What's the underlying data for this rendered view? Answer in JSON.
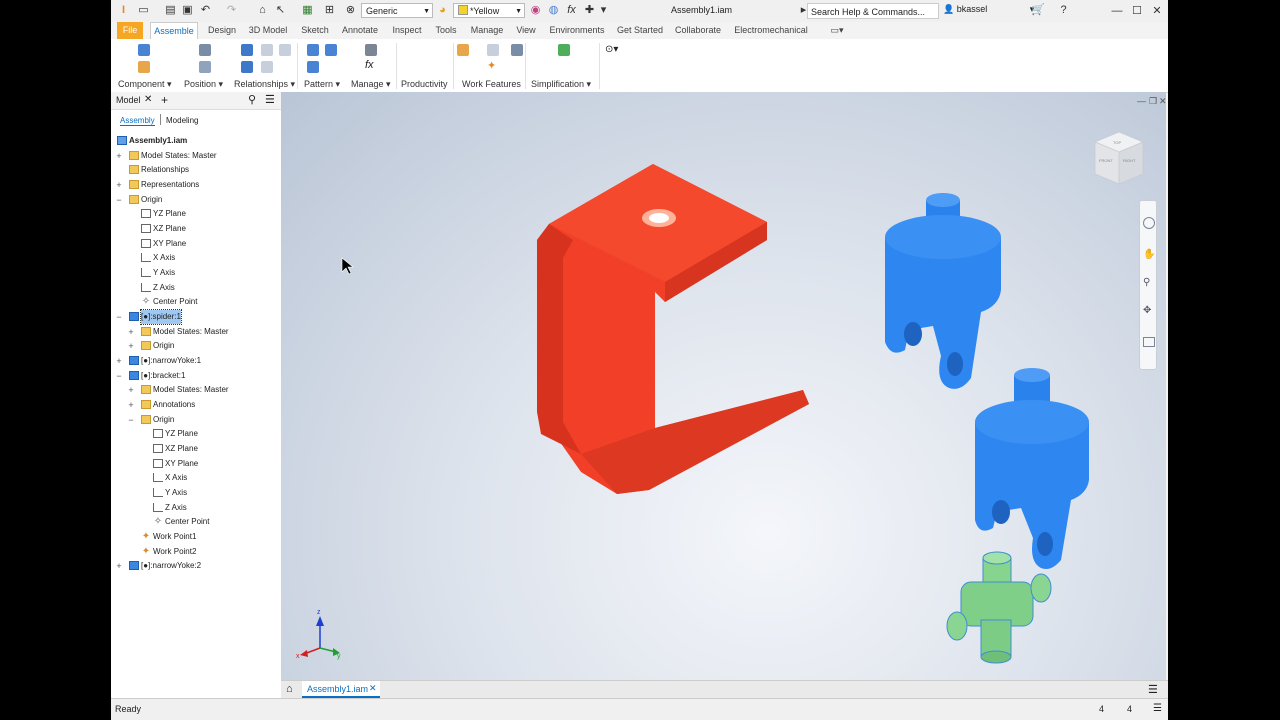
{
  "window": {
    "title": "Assembly1.iam",
    "search_placeholder": "Search Help & Commands...",
    "user": "bkassel",
    "appearance": "Generic",
    "color": "*Yellow"
  },
  "tabs": [
    "File",
    "Assemble",
    "Design",
    "3D Model",
    "Sketch",
    "Annotate",
    "Inspect",
    "Tools",
    "Manage",
    "View",
    "Environments",
    "Get Started",
    "Collaborate",
    "Electromechanical"
  ],
  "active_tab": "Assemble",
  "ribbon": {
    "panels": [
      "Component ▾",
      "Position ▾",
      "Relationships ▾",
      "Pattern ▾",
      "Manage ▾",
      "Productivity",
      "Work Features",
      "Simplification ▾"
    ]
  },
  "browser": {
    "tab_label": "Model",
    "views": [
      "Assembly",
      "Modeling"
    ],
    "tree": [
      {
        "label": "Assembly1.iam",
        "icon": "asm",
        "level": 0,
        "pm": "",
        "bold": true
      },
      {
        "label": "Model States: Master",
        "icon": "folder",
        "level": 1,
        "pm": "+"
      },
      {
        "label": "Relationships",
        "icon": "folder",
        "level": 1,
        "pm": ""
      },
      {
        "label": "Representations",
        "icon": "folder",
        "level": 1,
        "pm": "+"
      },
      {
        "label": "Origin",
        "icon": "folder",
        "level": 1,
        "pm": "−"
      },
      {
        "label": "YZ Plane",
        "icon": "plane",
        "level": 2,
        "pm": ""
      },
      {
        "label": "XZ Plane",
        "icon": "plane",
        "level": 2,
        "pm": ""
      },
      {
        "label": "XY Plane",
        "icon": "plane",
        "level": 2,
        "pm": ""
      },
      {
        "label": "X Axis",
        "icon": "axis",
        "level": 2,
        "pm": ""
      },
      {
        "label": "Y Axis",
        "icon": "axis",
        "level": 2,
        "pm": ""
      },
      {
        "label": "Z Axis",
        "icon": "axis",
        "level": 2,
        "pm": ""
      },
      {
        "label": "Center Point",
        "icon": "cpoint",
        "level": 2,
        "pm": ""
      },
      {
        "label": "[●]:spider:1",
        "icon": "part",
        "level": 1,
        "pm": "−",
        "selected": true
      },
      {
        "label": "Model States: Master",
        "icon": "folder",
        "level": 2,
        "pm": "+"
      },
      {
        "label": "Origin",
        "icon": "folder",
        "level": 2,
        "pm": "+"
      },
      {
        "label": "[●]:narrowYoke:1",
        "icon": "part",
        "level": 1,
        "pm": "+"
      },
      {
        "label": "[●]:bracket:1",
        "icon": "part",
        "level": 1,
        "pm": "−"
      },
      {
        "label": "Model States: Master",
        "icon": "folder",
        "level": 2,
        "pm": "+"
      },
      {
        "label": "Annotations",
        "icon": "folder",
        "level": 2,
        "pm": "+"
      },
      {
        "label": "Origin",
        "icon": "folder",
        "level": 2,
        "pm": "−"
      },
      {
        "label": "YZ Plane",
        "icon": "plane",
        "level": 3,
        "pm": ""
      },
      {
        "label": "XZ Plane",
        "icon": "plane",
        "level": 3,
        "pm": ""
      },
      {
        "label": "XY Plane",
        "icon": "plane",
        "level": 3,
        "pm": ""
      },
      {
        "label": "X Axis",
        "icon": "axis",
        "level": 3,
        "pm": ""
      },
      {
        "label": "Y Axis",
        "icon": "axis",
        "level": 3,
        "pm": ""
      },
      {
        "label": "Z Axis",
        "icon": "axis",
        "level": 3,
        "pm": ""
      },
      {
        "label": "Center Point",
        "icon": "cpoint",
        "level": 3,
        "pm": ""
      },
      {
        "label": "Work Point1",
        "icon": "point",
        "level": 2,
        "pm": ""
      },
      {
        "label": "Work Point2",
        "icon": "point",
        "level": 2,
        "pm": ""
      },
      {
        "label": "[●]:narrowYoke:2",
        "icon": "part",
        "level": 1,
        "pm": "+"
      }
    ]
  },
  "viewcube": {
    "front": "FRONT",
    "top": "TOP",
    "right": "RIGHT"
  },
  "triad": {
    "x": "x",
    "y": "y",
    "z": "z"
  },
  "doc_tab": "Assembly1.iam",
  "status": {
    "text": "Ready",
    "count1": "4",
    "count2": "4"
  },
  "colors": {
    "bracket": "#f33c2a",
    "yoke": "#2f8af0",
    "spider": "#7fd28a",
    "accent": "#0a6fc2"
  }
}
